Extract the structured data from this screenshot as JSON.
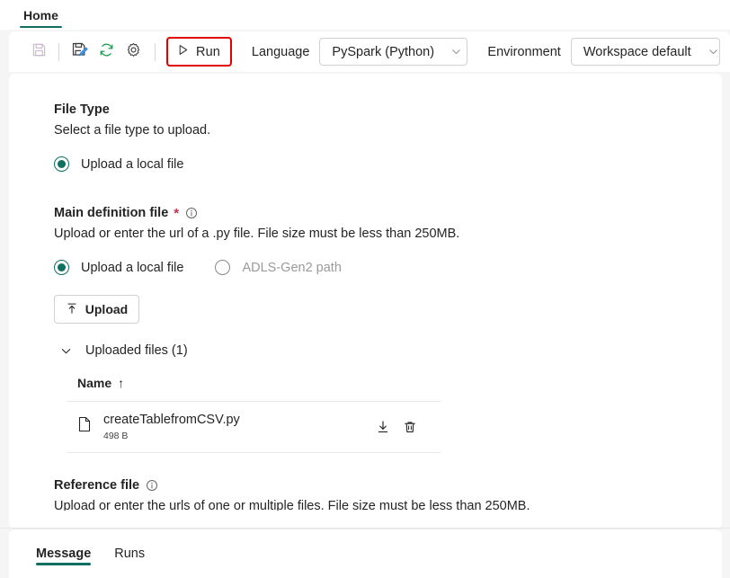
{
  "ribbon": {
    "tabs": [
      {
        "label": "Home",
        "active": true
      }
    ]
  },
  "toolbar": {
    "icons": [
      {
        "name": "save-icon",
        "title": "Save",
        "disabled": true
      },
      {
        "name": "save-as-icon",
        "title": "Save as",
        "disabled": false
      },
      {
        "name": "refresh-icon",
        "title": "Refresh",
        "disabled": false
      },
      {
        "name": "settings-gear-icon",
        "title": "Settings",
        "disabled": false
      }
    ],
    "run_label": "Run",
    "run_highlight_color": "#e00000",
    "language_label": "Language",
    "language_value": "PySpark (Python)",
    "environment_label": "Environment",
    "environment_value": "Workspace default"
  },
  "main": {
    "file_type": {
      "title": "File Type",
      "description": "Select a file type to upload.",
      "options": [
        {
          "label": "Upload a local file",
          "selected": true
        }
      ]
    },
    "main_definition_file": {
      "title": "Main definition file",
      "required_marker": "*",
      "description": "Upload or enter the url of a .py file. File size must be less than 250MB.",
      "options": [
        {
          "label": "Upload a local file",
          "selected": true,
          "disabled": false
        },
        {
          "label": "ADLS-Gen2 path",
          "selected": false,
          "disabled": true
        }
      ],
      "upload_button_label": "Upload",
      "uploaded_files_label": "Uploaded files (1)",
      "table": {
        "columns": [
          "Name"
        ],
        "sort_indicator": "↑",
        "rows": [
          {
            "name": "createTablefromCSV.py",
            "size": "498 B",
            "actions": [
              "download-icon",
              "delete-icon"
            ]
          }
        ]
      }
    },
    "reference_file": {
      "title": "Reference file",
      "description": "Upload or enter the urls of one or multiple files. File size must be less than 250MB."
    }
  },
  "bottom": {
    "tabs": [
      {
        "label": "Message",
        "active": true
      },
      {
        "label": "Runs",
        "active": false
      }
    ]
  },
  "colors": {
    "accent_teal": "#0f6f61",
    "required_red": "#c4314b",
    "highlight_red": "#e00000",
    "page_background": "#f5f5f5",
    "card_background": "#ffffff"
  }
}
